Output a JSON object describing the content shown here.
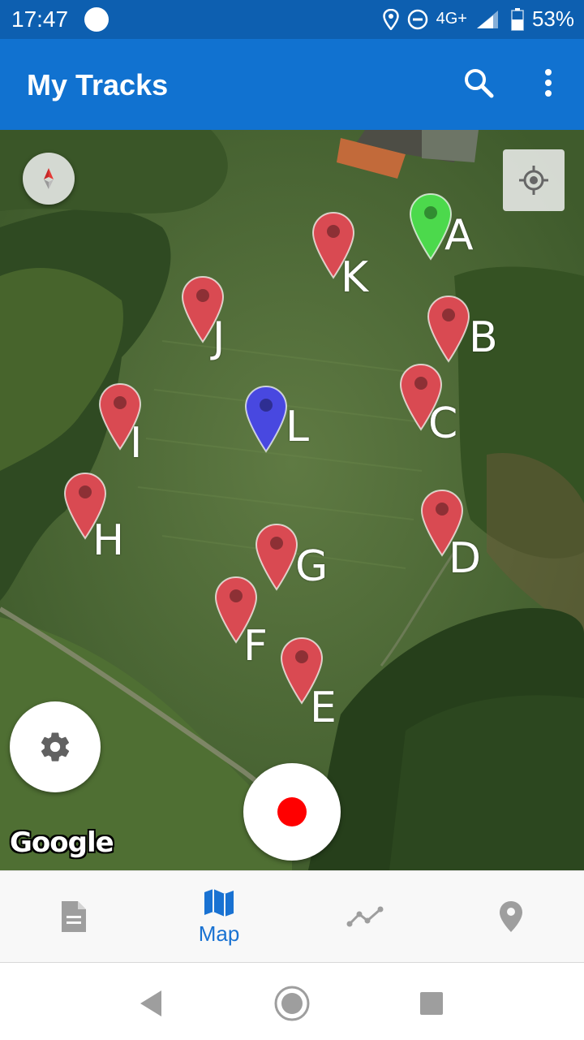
{
  "status": {
    "time": "17:47",
    "network": "4G+",
    "battery": "53%"
  },
  "app_bar": {
    "title": "My Tracks",
    "search_icon": "search-icon",
    "menu_icon": "more-vert-icon"
  },
  "map": {
    "markers": [
      {
        "label": "A",
        "color": "#4cd94c"
      },
      {
        "label": "B",
        "color": "#d94a52"
      },
      {
        "label": "C",
        "color": "#d94a52"
      },
      {
        "label": "D",
        "color": "#d94a52"
      },
      {
        "label": "E",
        "color": "#d94a52"
      },
      {
        "label": "F",
        "color": "#d94a52"
      },
      {
        "label": "G",
        "color": "#d94a52"
      },
      {
        "label": "H",
        "color": "#d94a52"
      },
      {
        "label": "I",
        "color": "#d94a52"
      },
      {
        "label": "J",
        "color": "#d94a52"
      },
      {
        "label": "K",
        "color": "#d94a52"
      },
      {
        "label": "L",
        "color": "#4848e0"
      }
    ],
    "attribution": "Google",
    "record_color": "#ff0000"
  },
  "bottom_nav": {
    "items": [
      {
        "icon": "document-icon",
        "label": "",
        "active": false
      },
      {
        "icon": "map-icon",
        "label": "Map",
        "active": true
      },
      {
        "icon": "chart-line-icon",
        "label": "",
        "active": false
      },
      {
        "icon": "place-marker-icon",
        "label": "",
        "active": false
      }
    ],
    "active_color": "#1972d2"
  }
}
